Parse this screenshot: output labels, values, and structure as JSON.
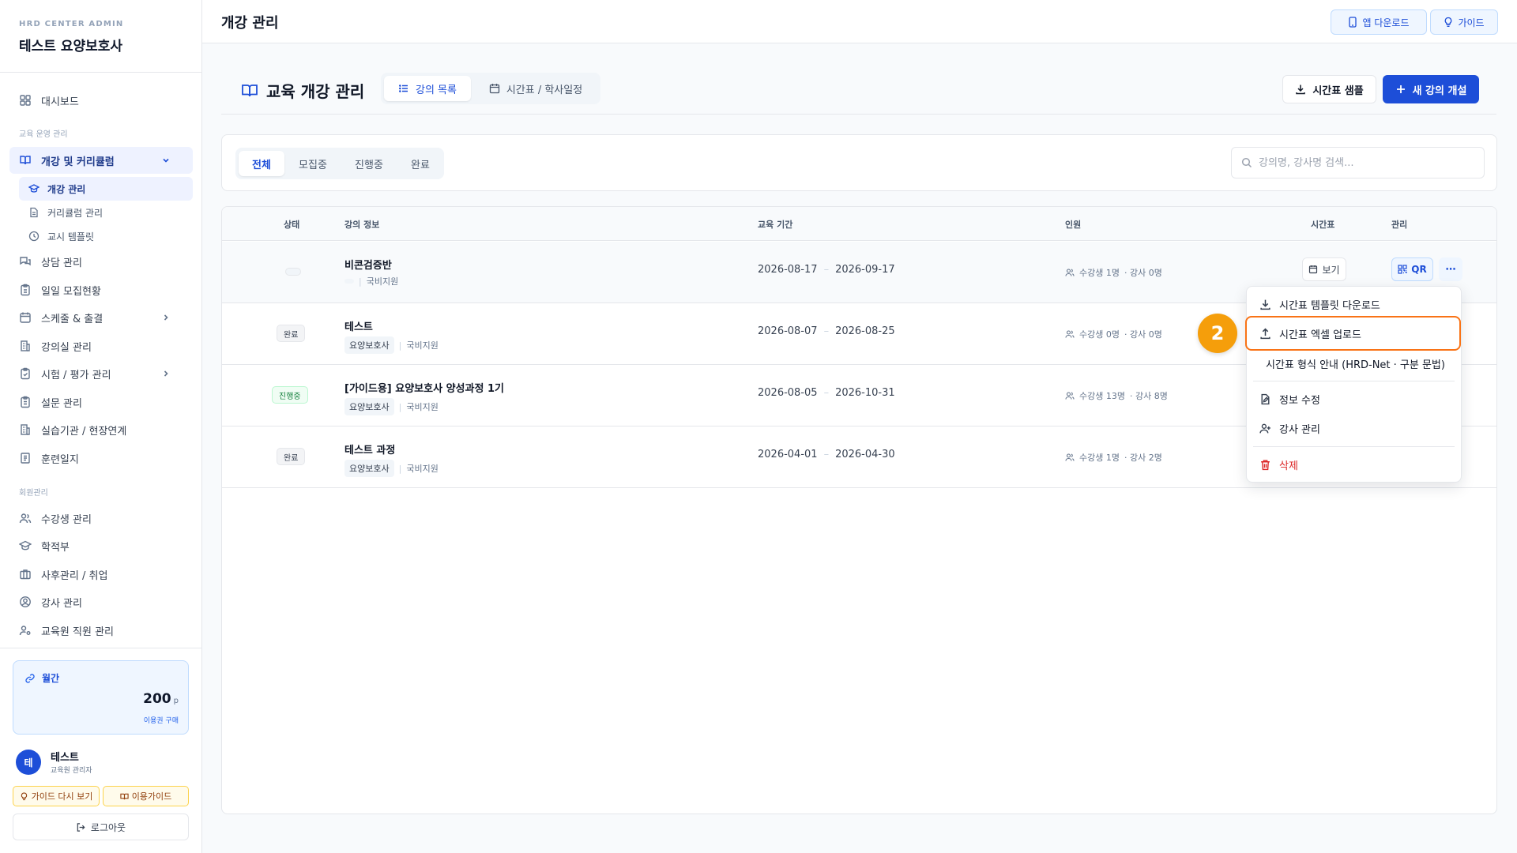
{
  "sidebar": {
    "brand_small": "HRD CENTER ADMIN",
    "brand_title": "테스트 요양보호사",
    "dashboard": "대시보드",
    "section_ops": "교육 운영 관리",
    "curriculum_group": "개강 및 커리큘럼",
    "sub_items": [
      "개강 관리",
      "커리큘럼 관리",
      "교시 템플릿"
    ],
    "items": [
      "상담 관리",
      "일일 모집현황",
      "스케줄 & 출결",
      "강의실 관리",
      "시험 / 평가 관리",
      "설문 관리",
      "실습기관 / 현장연계",
      "훈련일지"
    ],
    "section_members": "회원관리",
    "member_items": [
      "수강생 관리",
      "학적부",
      "사후관리 / 취업",
      "강사 관리",
      "교육원 직원 관리"
    ],
    "plan": {
      "label": "월간",
      "value": "200",
      "unit": "p",
      "buy": "이용권 구매"
    },
    "user": {
      "avatar": "테",
      "name": "테스트",
      "role": "교육원 관리자"
    },
    "guide_again": "가이드 다시 보기",
    "usage_guide": "이용가이드",
    "logout": "로그아웃"
  },
  "topbar": {
    "title": "개강 관리",
    "app_download": "앱 다운로드",
    "guide": "가이드"
  },
  "page": {
    "title": "교육 개강 관리",
    "view_tabs": [
      "강의 목록",
      "시간표 / 학사일정"
    ],
    "timetable_sample": "시간표 샘플",
    "new_course": "새 강의 개설"
  },
  "filters": {
    "tabs": [
      "전체",
      "모집중",
      "진행중",
      "완료"
    ],
    "search_placeholder": "강의명, 강사명 검색..."
  },
  "table": {
    "headers": [
      "상태",
      "강의 정보",
      "교육 기간",
      "인원",
      "시간표",
      "관리"
    ],
    "rows": [
      {
        "status": "",
        "name": "비콘검증반",
        "category": "",
        "funding": "국비지원",
        "start": "2026-08-17",
        "end": "2026-09-17",
        "students": "수강생 1명",
        "teachers": "강사 0명"
      },
      {
        "status": "완료",
        "name": "테스트",
        "category": "요양보호사",
        "funding": "국비지원",
        "start": "2026-08-07",
        "end": "2026-08-25",
        "students": "수강생 0명",
        "teachers": "강사 0명"
      },
      {
        "status": "진행중",
        "name": "[가이드용] 요양보호사 양성과정 1기",
        "category": "요양보호사",
        "funding": "국비지원",
        "start": "2026-08-05",
        "end": "2026-10-31",
        "students": "수강생 13명",
        "teachers": "강사 8명"
      },
      {
        "status": "완료",
        "name": "테스트 과정",
        "category": "요양보호사",
        "funding": "국비지원",
        "start": "2026-04-01",
        "end": "2026-04-30",
        "students": "수강생 1명",
        "teachers": "강사 2명"
      }
    ],
    "view_label": "보기",
    "qr_label": "QR",
    "more_label": "⋯"
  },
  "dropdown": {
    "items": [
      "시간표 템플릿 다운로드",
      "시간표 엑셀 업로드",
      "시간표 형식 안내 (HRD-Net · 구분 문법)",
      "정보 수정",
      "강사 관리",
      "삭제"
    ]
  },
  "callout": "2",
  "colors": {
    "accent": "#1d4ed8",
    "highlight": "#f97316",
    "callout": "#f59e0b",
    "danger": "#dc2626"
  }
}
